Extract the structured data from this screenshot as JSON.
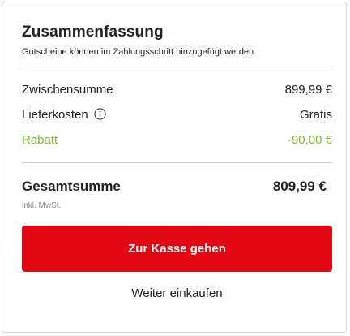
{
  "colors": {
    "accent_red": "#e30613",
    "discount_green": "#7ab829",
    "text": "#222222",
    "muted": "#8a8a8a",
    "divider": "#cfcfcf"
  },
  "summary": {
    "title": "Zusammenfassung",
    "subtitle": "Gutscheine können im Zahlungsschritt hinzugefügt werden",
    "rows": [
      {
        "label": "Zwischensumme",
        "value": "899,99 €"
      },
      {
        "label": "Lieferkosten",
        "value": "Gratis",
        "icon": "info-icon"
      },
      {
        "label": "Rabatt",
        "value": "-90,00 €"
      }
    ],
    "total": {
      "label": "Gesamtsumme",
      "value": "809,99 €",
      "tax_note": "inkl. MwSt."
    }
  },
  "actions": {
    "checkout_label": "Zur Kasse gehen",
    "continue_label": "Weiter einkaufen"
  }
}
